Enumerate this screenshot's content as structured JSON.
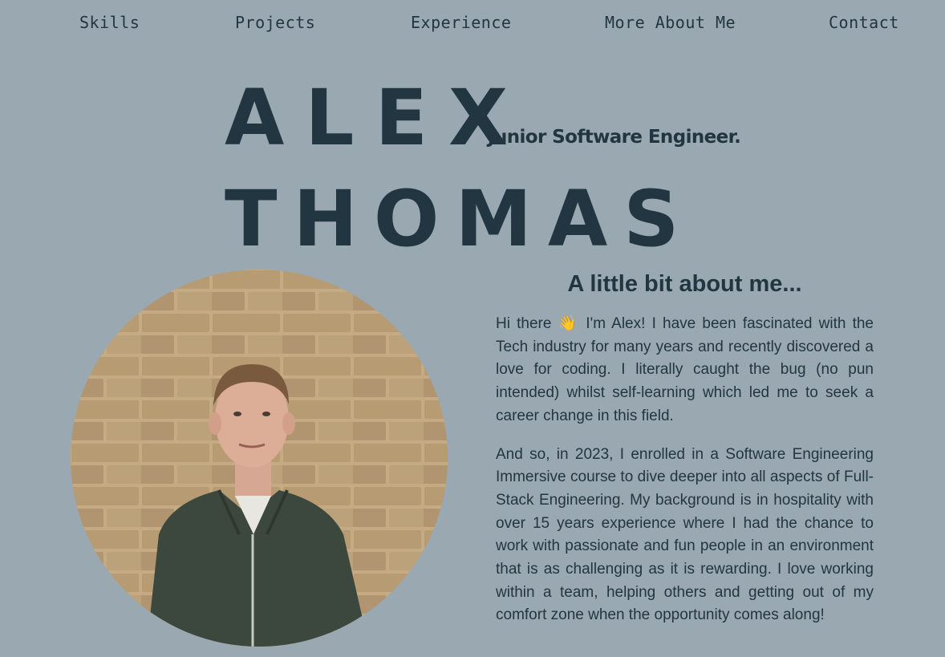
{
  "nav": {
    "items": [
      {
        "label": "Skills"
      },
      {
        "label": "Projects"
      },
      {
        "label": "Experience"
      },
      {
        "label": "More About Me"
      },
      {
        "label": "Contact"
      }
    ]
  },
  "hero": {
    "first_name": "ALEX",
    "last_name": "THOMAS",
    "tagline": "Junior Software Engineer."
  },
  "about": {
    "heading": "A little bit about me...",
    "paragraphs": [
      "Hi there 👋 I'm Alex! I have been fascinated with the Tech industry for many years and recently discovered a love for coding. I literally caught the bug (no pun intended) whilst self-learning which led me to seek a career change in this field.",
      "And so, in 2023, I enrolled in a Software Engineering Immersive course to dive deeper into all aspects of Full-Stack Engineering. My background is in hospitality with over 15 years experience where I had the chance to work with passionate and fun people in an environment that is as challenging as it is rewarding. I love working within a team, helping others and getting out of my comfort zone when the opportunity comes along!"
    ]
  },
  "colors": {
    "background": "#9aa8b1",
    "text": "#223641"
  }
}
